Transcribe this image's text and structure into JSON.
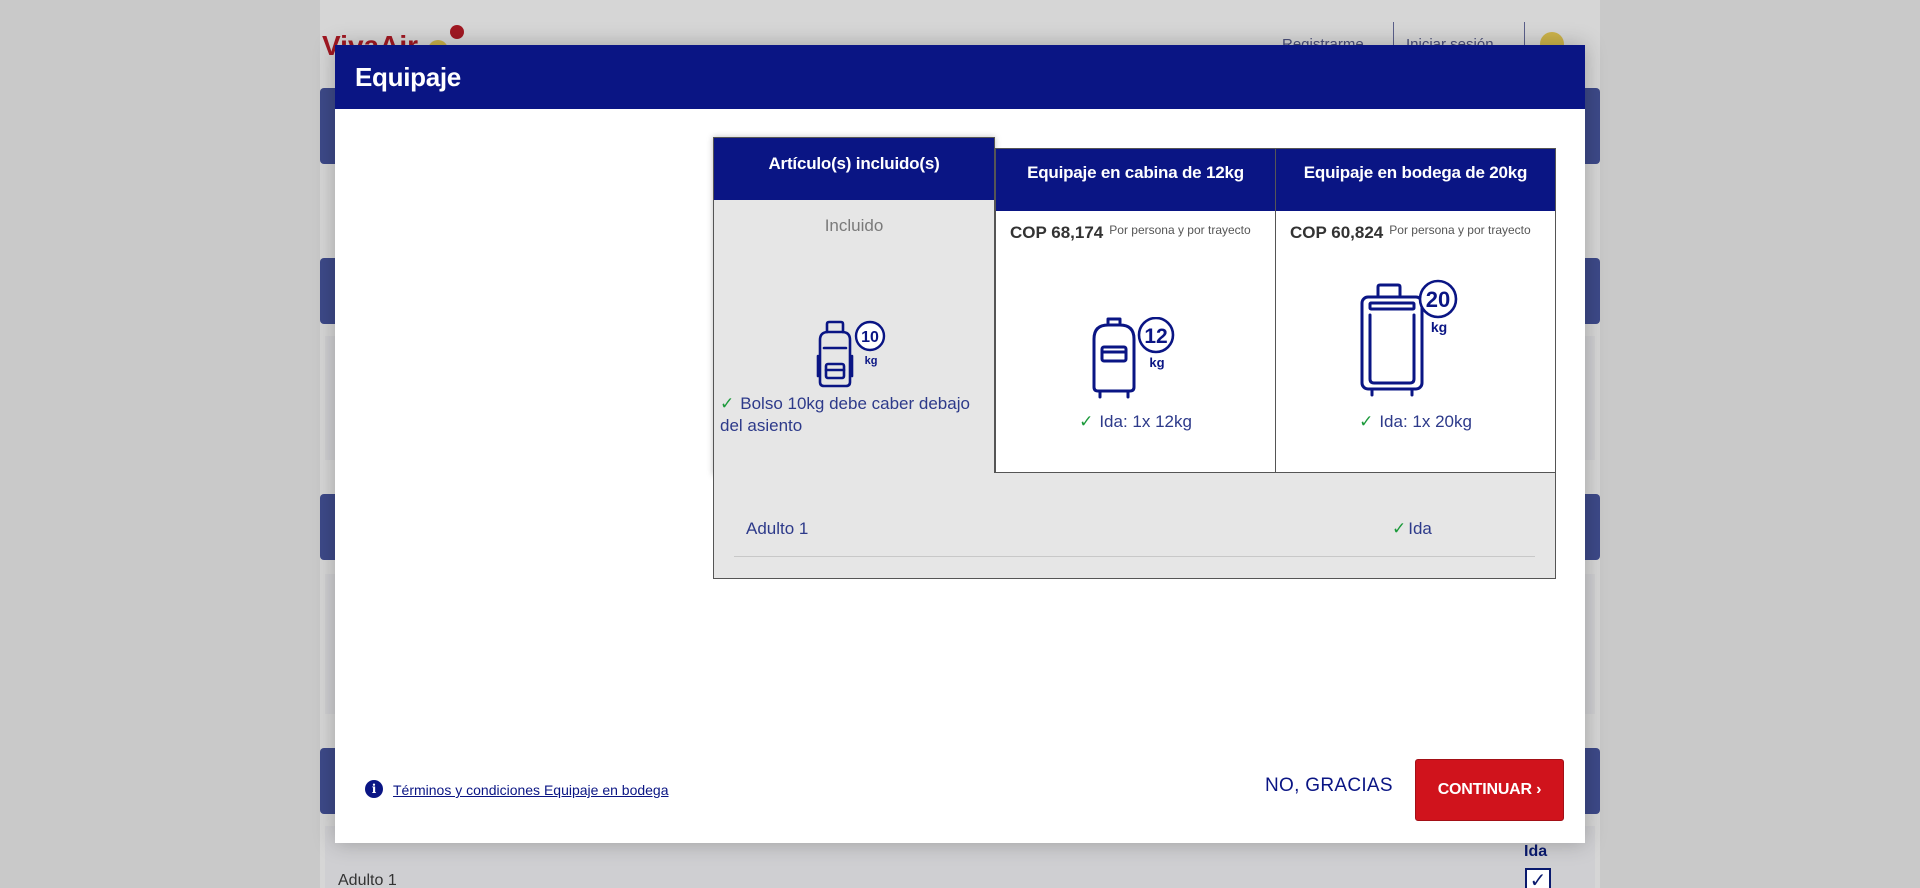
{
  "background": {
    "logo_text": "VivaAir",
    "nav_register": "Registrarme",
    "nav_login": "Iniciar sesión",
    "row_label": "Adulto 1",
    "col_label": "Ida",
    "check_mark": "✓"
  },
  "modal": {
    "title": "Equipaje",
    "included_option": {
      "header": "Artículo(s) incluido(s)",
      "label": "Incluido",
      "weight_number": "10",
      "weight_unit": "kg",
      "description": "Bolso 10kg debe caber debajo del asiento",
      "icon": "backpack-icon"
    },
    "cabin_option": {
      "header": "Equipaje en cabina de 12kg",
      "price": "COP 68,174",
      "per_note": "Por persona y por trayecto",
      "weight_number": "12",
      "weight_unit": "kg",
      "line": "Ida: 1x 12kg",
      "icon": "cabin-bag-icon"
    },
    "hold_option": {
      "header": "Equipaje en bodega de 20kg",
      "price": "COP 60,824",
      "per_note": "Por persona y por trayecto",
      "weight_number": "20",
      "weight_unit": "kg",
      "line": "Ida: 1x 20kg",
      "icon": "suitcase-icon"
    },
    "passenger": {
      "name": "Adulto 1",
      "segment": "Ida"
    },
    "footer": {
      "terms_link": "Términos y condiciones Equipaje en bodega",
      "no_thanks": "NO, GRACIAS",
      "continue": "CONTINUAR",
      "continue_chevron": "›"
    }
  },
  "colors": {
    "brand_navy": "#0a1584",
    "accent_red": "#d0131c",
    "check_green": "#1c9a3b"
  }
}
